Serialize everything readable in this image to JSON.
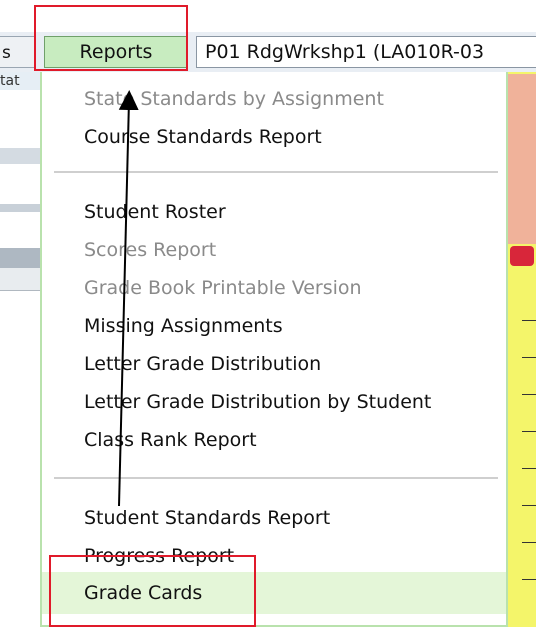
{
  "toolbar": {
    "left_tab_partial": "s",
    "reports_tab": "Reports",
    "course_label": "P01   RdgWrkshp1 (LA010R-03"
  },
  "background": {
    "left_partial_label": "tat"
  },
  "menu": {
    "groups": [
      [
        {
          "label": "State Standards by Assignment",
          "enabled": false
        },
        {
          "label": "Course Standards Report",
          "enabled": true
        }
      ],
      [
        {
          "label": "Student Roster",
          "enabled": true
        },
        {
          "label": "Scores Report",
          "enabled": false
        },
        {
          "label": "Grade Book Printable Version",
          "enabled": false
        },
        {
          "label": "Missing Assignments",
          "enabled": true
        },
        {
          "label": "Letter Grade Distribution",
          "enabled": true
        },
        {
          "label": "Letter Grade Distribution by Student",
          "enabled": true
        },
        {
          "label": "Class Rank Report",
          "enabled": true
        }
      ],
      [
        {
          "label": "Student Standards Report",
          "enabled": true
        },
        {
          "label": "Progress Report",
          "enabled": true
        },
        {
          "label": "Grade Cards",
          "enabled": true,
          "highlighted": true
        }
      ]
    ]
  },
  "colors": {
    "accent_green": "#c8ecc0",
    "highlight_green": "#e4f6d8",
    "annotation_red": "#e01a2a",
    "column_yellow": "#f4f56a",
    "column_salmon": "#f0b29a"
  }
}
